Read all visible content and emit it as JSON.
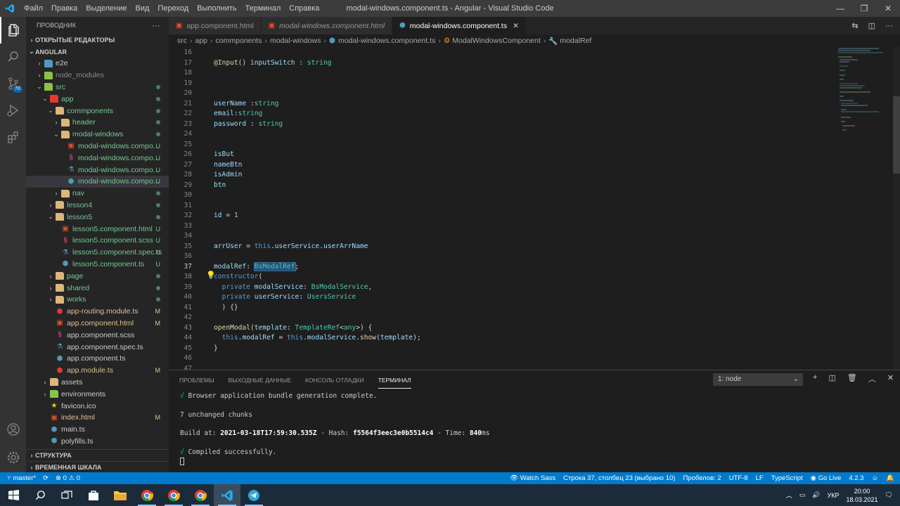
{
  "window": {
    "title": "modal-windows.component.ts - Angular - Visual Studio Code",
    "menu": [
      "Файл",
      "Правка",
      "Выделение",
      "Вид",
      "Переход",
      "Выполнить",
      "Терминал",
      "Справка"
    ]
  },
  "activity": {
    "scm_badge": "70"
  },
  "sidebar": {
    "title": "ПРОВОДНИК",
    "more": "···",
    "open_editors": "ОТКРЫТЫЕ РЕДАКТОРЫ",
    "root": "ANGULAR",
    "items": [
      {
        "label": "e2e",
        "color": "#cccccc",
        "status": ""
      },
      {
        "label": "node_modules",
        "color": "#8c8c8c",
        "status": ""
      },
      {
        "label": "src",
        "color": "#73c991",
        "status": "dot"
      },
      {
        "label": "app",
        "color": "#73c991",
        "status": "dot"
      },
      {
        "label": "commponents",
        "color": "#73c991",
        "status": "dot"
      },
      {
        "label": "header",
        "color": "#73c991",
        "status": "dot"
      },
      {
        "label": "modal-windows",
        "color": "#73c991",
        "status": "dot"
      },
      {
        "label": "modal-windows.compo...",
        "color": "#73c991",
        "status": "U"
      },
      {
        "label": "modal-windows.compo...",
        "color": "#73c991",
        "status": "U"
      },
      {
        "label": "modal-windows.compo...",
        "color": "#73c991",
        "status": "U"
      },
      {
        "label": "modal-windows.compo...",
        "color": "#73c991",
        "status": "U"
      },
      {
        "label": "nav",
        "color": "#73c991",
        "status": "dot"
      },
      {
        "label": "lesson4",
        "color": "#73c991",
        "status": "dot"
      },
      {
        "label": "lesson5",
        "color": "#73c991",
        "status": "dot"
      },
      {
        "label": "lesson5.component.html",
        "color": "#73c991",
        "status": "U"
      },
      {
        "label": "lesson5.component.scss",
        "color": "#73c991",
        "status": "U"
      },
      {
        "label": "lesson5.component.spec.ts",
        "color": "#73c991",
        "status": "U"
      },
      {
        "label": "lesson5.component.ts",
        "color": "#73c991",
        "status": "U"
      },
      {
        "label": "page",
        "color": "#73c991",
        "status": "dot"
      },
      {
        "label": "shared",
        "color": "#73c991",
        "status": "dot"
      },
      {
        "label": "works",
        "color": "#73c991",
        "status": "dot"
      },
      {
        "label": "app-routing.module.ts",
        "color": "#e2c08d",
        "status": "M"
      },
      {
        "label": "app.component.html",
        "color": "#e2c08d",
        "status": "M"
      },
      {
        "label": "app.component.scss",
        "color": "#cccccc",
        "status": ""
      },
      {
        "label": "app.component.spec.ts",
        "color": "#cccccc",
        "status": ""
      },
      {
        "label": "app.component.ts",
        "color": "#cccccc",
        "status": ""
      },
      {
        "label": "app.module.ts",
        "color": "#e2c08d",
        "status": "M"
      },
      {
        "label": "assets",
        "color": "#cccccc",
        "status": ""
      },
      {
        "label": "environments",
        "color": "#cccccc",
        "status": ""
      },
      {
        "label": "favicon.ico",
        "color": "#cccccc",
        "status": ""
      },
      {
        "label": "index.html",
        "color": "#e2c08d",
        "status": "M"
      },
      {
        "label": "main.ts",
        "color": "#cccccc",
        "status": ""
      },
      {
        "label": "polyfills.ts",
        "color": "#cccccc",
        "status": ""
      }
    ],
    "outline": "СТРУКТУРА",
    "timeline": "ВРЕМЕННАЯ ШКАЛА"
  },
  "tabs": [
    {
      "label": "app.component.html",
      "icon": "html-file-icon"
    },
    {
      "label": "modal-windows.component.html",
      "icon": "html-file-icon"
    },
    {
      "label": "modal-windows.component.ts",
      "icon": "angular-file-icon",
      "close": "✕"
    }
  ],
  "breadcrumbs": [
    "src",
    "app",
    "commponents",
    "modal-windows",
    "modal-windows.component.ts",
    "ModalWindowsComponent",
    "modalRef"
  ],
  "editor": {
    "lines": [
      {
        "n": "16",
        "html": ""
      },
      {
        "n": "17",
        "html": "<span class='d'>@Input</span><span class='p'>() </span><span class='v'>inputSwitch</span><span class='p'> : </span><span class='t'>string</span>"
      },
      {
        "n": "18",
        "html": ""
      },
      {
        "n": "19",
        "html": ""
      },
      {
        "n": "20",
        "html": ""
      },
      {
        "n": "21",
        "html": "<span class='v'>userName</span><span class='p'> :</span><span class='t'>string</span>"
      },
      {
        "n": "22",
        "html": "<span class='v'>email</span><span class='p'>:</span><span class='t'>string</span>"
      },
      {
        "n": "23",
        "html": "<span class='v'>password</span><span class='p'> : </span><span class='t'>string</span>"
      },
      {
        "n": "24",
        "html": ""
      },
      {
        "n": "25",
        "html": ""
      },
      {
        "n": "26",
        "html": "<span class='v'>isBut</span>"
      },
      {
        "n": "27",
        "html": "<span class='v'>nameBtn</span>"
      },
      {
        "n": "28",
        "html": "<span class='v'>isAdmin</span>"
      },
      {
        "n": "29",
        "html": "<span class='v'>btn</span>"
      },
      {
        "n": "30",
        "html": ""
      },
      {
        "n": "31",
        "html": ""
      },
      {
        "n": "32",
        "html": "<span class='v'>id</span><span class='p'> = </span><span class='n'>1</span>"
      },
      {
        "n": "33",
        "html": ""
      },
      {
        "n": "34",
        "html": ""
      },
      {
        "n": "35",
        "html": "<span class='v'>arrUser</span><span class='p'> = </span><span class='k'>this</span><span class='p'>.</span><span class='v'>userService</span><span class='p'>.</span><span class='v'>userArrName</span>"
      },
      {
        "n": "36",
        "html": ""
      },
      {
        "n": "37",
        "html": "<span class='v'>modalRef</span><span class='p'>: </span><span class='t hl'>BsModalRef</span><span class='p'>;</span>"
      },
      {
        "n": "38",
        "html": "<span class='k'>constructor</span><span class='p'>(</span>"
      },
      {
        "n": "39",
        "html": "  <span class='k'>private</span><span class='p'> </span><span class='v'>modalService</span><span class='p'>: </span><span class='t'>BsModalService</span><span class='p'>,</span>"
      },
      {
        "n": "40",
        "html": "  <span class='k'>private</span><span class='p'> </span><span class='v'>userService</span><span class='p'>: </span><span class='t'>UsersService</span>"
      },
      {
        "n": "41",
        "html": "<span class='p'>  ) {}</span>"
      },
      {
        "n": "42",
        "html": ""
      },
      {
        "n": "43",
        "html": "<span class='f'>openModal</span><span class='p'>(</span><span class='v'>template</span><span class='p'>: </span><span class='t'>TemplateRef</span><span class='p'>&lt;</span><span class='t'>any</span><span class='p'>&gt;) {</span>"
      },
      {
        "n": "44",
        "html": "  <span class='k'>this</span><span class='p'>.</span><span class='v'>modalRef</span><span class='p'> = </span><span class='k'>this</span><span class='p'>.</span><span class='v'>modalService</span><span class='p'>.</span><span class='f'>show</span><span class='p'>(</span><span class='v'>template</span><span class='p'>);</span>"
      },
      {
        "n": "45",
        "html": "<span class='p'>}</span>"
      },
      {
        "n": "46",
        "html": ""
      },
      {
        "n": "47",
        "html": ""
      }
    ],
    "current_line": "37"
  },
  "panel": {
    "tabs": [
      "ПРОБЛЕМЫ",
      "ВЫХОДНЫЕ ДАННЫЕ",
      "КОНСОЛЬ ОТЛАДКИ",
      "ТЕРМИНАЛ"
    ],
    "terminal_select": "1: node",
    "terminal": [
      "<span class='ok'>√</span> Browser application bundle generation complete.",
      "",
      "7 unchanged chunks",
      "",
      "Build at: <b>2021-03-18T17:59:30.535Z</b> - Hash: <b>f5564f3eec3e0b5514c4</b> - Time: <b>840</b>ms",
      "",
      "<span class='ok'>√</span> Compiled successfully.",
      "<span class='cursor'></span>"
    ]
  },
  "status": {
    "branch": "master*",
    "errors": "0",
    "warnings": "0",
    "watch_sass": "Watch Sass",
    "position": "Строка 37, столбец 23 (выбрано 10)",
    "spaces": "Пробелов: 2",
    "encoding": "UTF-8",
    "eol": "LF",
    "language": "TypeScript",
    "go_live": "Go Live",
    "version": "4.2.3"
  },
  "taskbar": {
    "lang": "УКР",
    "time": "20:00",
    "date": "18.03.2021"
  }
}
